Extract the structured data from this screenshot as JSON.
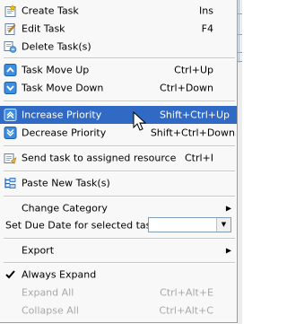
{
  "menu": {
    "create_task": {
      "label": "Create Task",
      "shortcut": "Ins"
    },
    "edit_task": {
      "label": "Edit Task",
      "shortcut": "F4"
    },
    "delete_task": {
      "label": "Delete Task(s)"
    },
    "task_move_up": {
      "label": "Task Move Up",
      "shortcut": "Ctrl+Up"
    },
    "task_move_down": {
      "label": "Task Move Down",
      "shortcut": "Ctrl+Down"
    },
    "increase_priority": {
      "label": "Increase Priority",
      "shortcut": "Shift+Ctrl+Up"
    },
    "decrease_priority": {
      "label": "Decrease Priority",
      "shortcut": "Shift+Ctrl+Down"
    },
    "send_task": {
      "label": "Send task to assigned resource",
      "shortcut": "Ctrl+I"
    },
    "paste_new_task": {
      "label": "Paste New Task(s)"
    },
    "change_category": {
      "label": "Change Category"
    },
    "set_due_date": {
      "label": "Set Due Date for selected tasks",
      "value": ""
    },
    "export": {
      "label": "Export"
    },
    "always_expand": {
      "label": "Always Expand",
      "checked": true
    },
    "expand_all": {
      "label": "Expand All",
      "shortcut": "Ctrl+Alt+E"
    },
    "collapse_all": {
      "label": "Collapse All",
      "shortcut": "Ctrl+Alt+C"
    }
  },
  "colors": {
    "highlight": "#316ac5",
    "disabled_text": "#a8a8a8",
    "menu_background": "#f8f8f8"
  },
  "icons": [
    "create-task-icon",
    "edit-task-icon",
    "delete-task-icon",
    "move-up-icon",
    "move-down-icon",
    "increase-priority-icon",
    "decrease-priority-icon",
    "send-task-icon",
    "paste-task-icon",
    "checkmark-icon",
    "submenu-arrow-icon",
    "dropdown-arrow-icon",
    "mouse-cursor-icon"
  ]
}
